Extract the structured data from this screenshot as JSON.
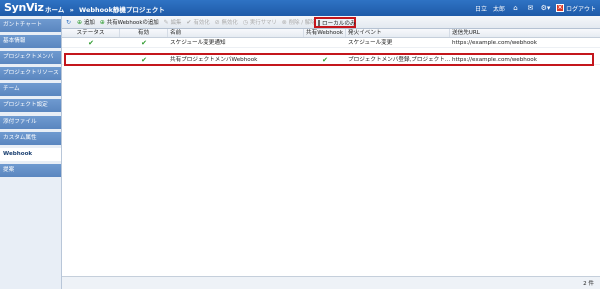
{
  "header": {
    "logo": "SynViz",
    "crumbs": [
      "ホーム",
      "Webhook静機プロジェクト"
    ],
    "crumb_sep": "»",
    "user": "日立　太郎",
    "logout": "ログアウト"
  },
  "sidebar": {
    "items": [
      {
        "label": "ガントチャート",
        "active": false
      },
      {
        "label": "基本情報",
        "active": false
      },
      {
        "label": "プロジェクトメンバ",
        "active": false
      },
      {
        "label": "プロジェクトリソース",
        "active": false
      },
      {
        "label": "チーム",
        "active": false
      },
      {
        "label": "プロジェクト設定",
        "active": false
      },
      {
        "label": "添付ファイル",
        "active": false
      },
      {
        "label": "カスタム属性",
        "active": false
      },
      {
        "label": "Webhook",
        "active": true
      },
      {
        "label": "提案",
        "active": false
      }
    ]
  },
  "toolbar": {
    "add": "追加",
    "add_shared": "共有Webhookの追加",
    "edit": "編集",
    "enable": "有効化",
    "disable": "無効化",
    "history": "実行サマリ",
    "delete": "削除 / 解除",
    "local_only": "ローカルのみ"
  },
  "grid": {
    "columns": [
      "ステータス",
      "有効",
      "名前",
      "共有Webhook",
      "発火イベント",
      "送信先URL"
    ],
    "rows": [
      {
        "status": "✔",
        "enabled": "✔",
        "name": "スケジュール変更通知",
        "shared": "",
        "event": "スケジュール変更",
        "url": "https://example.com/webhook"
      },
      {
        "status": "",
        "enabled": "✔",
        "name": "共有プロジェクトメンバWebhook",
        "shared": "✔",
        "event": "プロジェクトメンバ登録,プロジェクト...",
        "url": "https://example.com/webhook"
      }
    ]
  },
  "status": {
    "count": "2 件"
  },
  "colors": {
    "header": "#2f73c4",
    "highlight": "#c4161c",
    "check": "#2c9a2c"
  }
}
